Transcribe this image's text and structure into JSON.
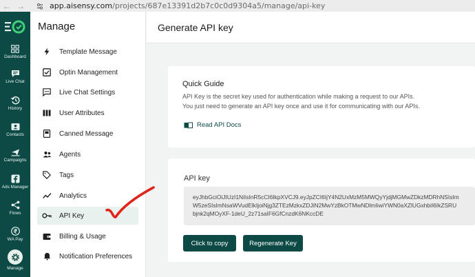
{
  "browser": {
    "url_host": "app.aisensy.com",
    "url_path": "/projects/687e13391d2b7c0c0d9304a5/manage/api-key"
  },
  "rail": {
    "items": [
      {
        "label": "Dashboard",
        "icon": "dashboard-icon"
      },
      {
        "label": "Live Chat",
        "icon": "chat-icon"
      },
      {
        "label": "History",
        "icon": "history-icon"
      },
      {
        "label": "Contacts",
        "icon": "contacts-icon"
      },
      {
        "label": "Campaigns",
        "icon": "campaigns-icon"
      },
      {
        "label": "Ads Manager",
        "icon": "facebook-icon"
      },
      {
        "label": "Flows",
        "icon": "flows-icon"
      },
      {
        "label": "WA Pay",
        "icon": "rupee-icon"
      },
      {
        "label": "Manage",
        "icon": "gear-icon"
      }
    ]
  },
  "sidebar": {
    "title": "Manage",
    "items": [
      {
        "label": "Template Message",
        "icon": "lightning-icon"
      },
      {
        "label": "Optin Management",
        "icon": "checkbox-icon"
      },
      {
        "label": "Live Chat Settings",
        "icon": "chat-settings-icon"
      },
      {
        "label": "User Attributes",
        "icon": "columns-icon"
      },
      {
        "label": "Canned Message",
        "icon": "document-icon"
      },
      {
        "label": "Agents",
        "icon": "agents-icon"
      },
      {
        "label": "Tags",
        "icon": "tag-icon"
      },
      {
        "label": "Analytics",
        "icon": "analytics-icon"
      },
      {
        "label": "API Key",
        "icon": "key-icon",
        "active": true
      },
      {
        "label": "Billing & Usage",
        "icon": "wallet-icon"
      },
      {
        "label": "Notification Preferences",
        "icon": "bell-icon"
      }
    ]
  },
  "header": {
    "title": "Generate API key"
  },
  "quick_guide": {
    "title": "Quick Guide",
    "line1": "API Key is the secret key used for authentication while making a request to our APIs.",
    "line2": "You just need to generate an API key once and use it for communicating with our APIs.",
    "docs_link": "Read API Docs"
  },
  "api_key": {
    "label": "API key",
    "line1": "eyJhbGciOiJIUzI1NiIsInR5cCI6IkpXVCJ9.eyJpZCI6IjY4N2UxMzM5MWQyYjdjMGMwZDkzMDRhNSIsIm",
    "line2": "W5zeSIsImNsaWVudElkIjoiNjg3ZTEzMzkxZDJiN2MwYzBkOTMwNDlmIiwiYWN0aXZlUGxhbiI6IkZSRU",
    "line3": "bjnk2qMOyXF-1deU_2z71saIF6GfCnzdK6NKccDE",
    "copy_button": "Click to copy",
    "regenerate_button": "Regenerate Key"
  },
  "colors": {
    "brand": "#0d4a45",
    "checkmark": "#e0241b"
  }
}
